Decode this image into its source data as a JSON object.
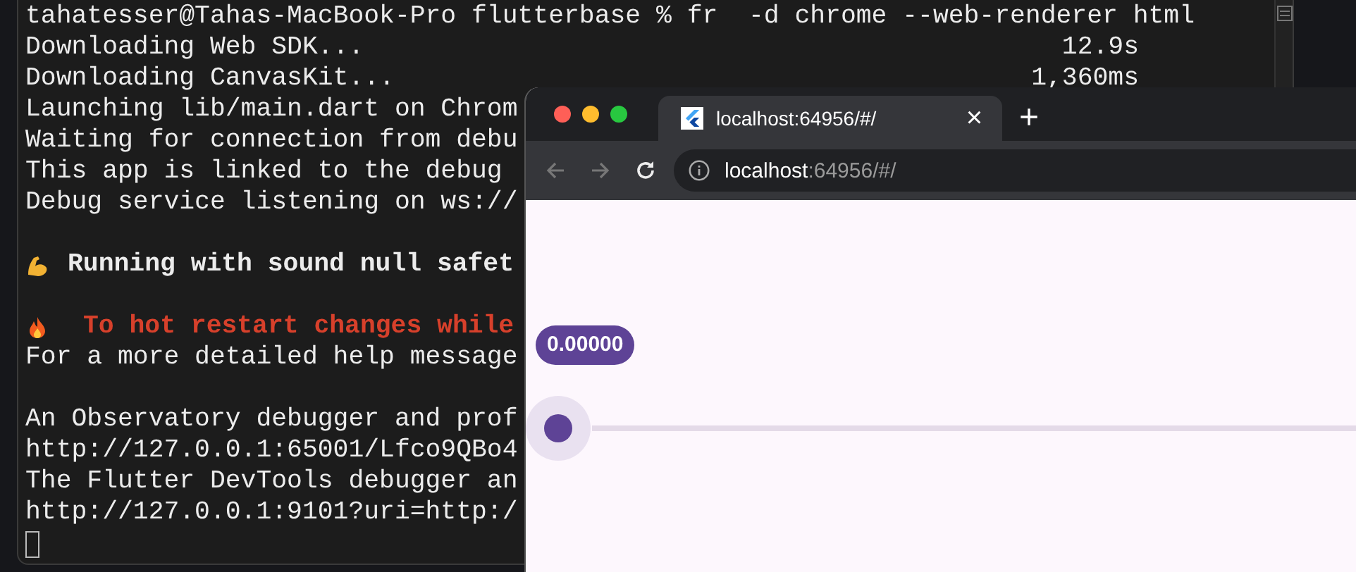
{
  "terminal": {
    "lines": [
      {
        "kind": "command",
        "text": "tahatesser@Tahas-MacBook-Pro flutterbase % fr  -d chrome --web-renderer html"
      },
      {
        "kind": "timed",
        "text": "Downloading Web SDK...",
        "time": "12.9s"
      },
      {
        "kind": "timed",
        "text": "Downloading CanvasKit...",
        "time": "1,360ms"
      },
      {
        "kind": "plain",
        "text": "Launching lib/main.dart on Chrom"
      },
      {
        "kind": "plain",
        "text": "Waiting for connection from debu"
      },
      {
        "kind": "plain",
        "text": "This app is linked to the debug"
      },
      {
        "kind": "plain",
        "text": "Debug service listening on ws://"
      },
      {
        "kind": "blank"
      },
      {
        "kind": "strong",
        "text": "Running with sound null safet"
      },
      {
        "kind": "blank"
      },
      {
        "kind": "hot",
        "text": "To hot restart changes while"
      },
      {
        "kind": "plain",
        "text": "For a more detailed help message"
      },
      {
        "kind": "blank"
      },
      {
        "kind": "plain",
        "text": "An Observatory debugger and prof"
      },
      {
        "kind": "plain",
        "text": "http://127.0.0.1:65001/Lfco9QBo4"
      },
      {
        "kind": "plain",
        "text": "The Flutter DevTools debugger an"
      },
      {
        "kind": "plain",
        "text": "http://127.0.0.1:9101?uri=http:/"
      },
      {
        "kind": "cursor"
      }
    ]
  },
  "browser": {
    "tab": {
      "title": "localhost:64956/#/",
      "selected": true,
      "close": "×"
    },
    "new_tab": "+",
    "address": {
      "host": "localhost",
      "rest": ":64956/#/"
    },
    "slider": {
      "level": 0,
      "label": "0.00000"
    }
  }
}
